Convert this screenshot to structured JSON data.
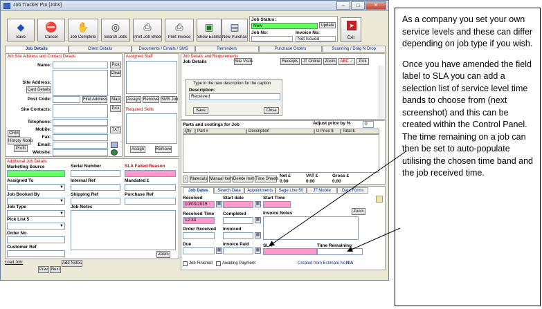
{
  "window": {
    "title": "Job Tracker Pro [Jobs]"
  },
  "toolbar": {
    "buttons": [
      {
        "label": "Save",
        "icon": "save-icon",
        "glyph": "◆"
      },
      {
        "label": "Cancel",
        "icon": "cancel-icon",
        "glyph": "⛔"
      },
      {
        "label": "Job Complete",
        "icon": "thumbs-up-icon",
        "glyph": "✋"
      },
      {
        "label": "Search Jobs",
        "icon": "binoculars-icon",
        "glyph": "◎"
      },
      {
        "label": "Print Job Sheet",
        "icon": "printer-icon",
        "glyph": "⎙"
      },
      {
        "label": "Print Invoice",
        "icon": "printer-icon",
        "glyph": "⎙"
      },
      {
        "label": "Show Estimate",
        "icon": "estimate-icon",
        "glyph": "▣"
      },
      {
        "label": "New Purchase",
        "icon": "purchase-icon",
        "glyph": "▤"
      }
    ],
    "exit_label": "Exit"
  },
  "status": {
    "job_status_label": "Job Status:",
    "job_status_value": "New",
    "update_label": "Update",
    "job_no_label": "Job No:",
    "invoice_no_label": "Invoice No:",
    "invoice_no_value": "Not Issued"
  },
  "tabs": [
    "Job Details",
    "Client Details",
    "Documents / Emails / SMS",
    "Reminders",
    "Purchase Orders",
    "Scanning / Drag N Drop"
  ],
  "left": {
    "section_title": "Job Site Address and Contact Details",
    "name_label": "Name:",
    "pick_label": "Pick",
    "clear_label": "Clear",
    "site_address_label": "Site Address:",
    "card_details_label": "Card Details",
    "post_code_label": "Post Code:",
    "find_address_label": "Find Address",
    "map_label": "Map",
    "site_contacts_label": "Site Contacts:",
    "pick2_label": "Pick",
    "telephone_label": "Telephone:",
    "mobile_label": "Mobile:",
    "txt_label": "TXT",
    "crm_label": "CRM",
    "fax_label": "Fax:",
    "history_notes_label": "History Notes",
    "email_label": "Email:",
    "profit_label": "Profit",
    "website_label": "Website:"
  },
  "staff": {
    "section_title": "Assigned Staff",
    "assign_label": "Assign",
    "remove_label": "Remove",
    "sms_job_label": "SMS Job",
    "required_skills_title": "Required Skills",
    "assign2_label": "Assign",
    "remove2_label": "Remove"
  },
  "additional": {
    "section_title": "Additional Job Details",
    "marketing_source_label": "Marketing Source",
    "serial_number_label": "Serial Number",
    "sla_failed_label": "SLA Failed Reason",
    "assigned_to_label": "Assigned To",
    "internal_ref_label": "Internal Ref",
    "mandated_label": "Mandated £",
    "job_booked_by_label": "Job Booked By",
    "shipping_ref_label": "Shipping Ref",
    "purchase_ref_label": "Purchase Ref",
    "job_type_label": "Job Type",
    "job_notes_label": "Job Notes",
    "pick_list_label": "Pick List 5",
    "order_no_label": "Order No",
    "customer_ref_label": "Customer Ref",
    "zoom_label": "Zoom",
    "load_job_label": "Load Job:",
    "add_notes_label": "Add Notes",
    "prev_label": "Prev",
    "next_label": "Next"
  },
  "job_details": {
    "section_title": "Job Details and Requirements",
    "title": "Job Details",
    "site_visits_label": "Site Visits",
    "receipts_label": "Receipts",
    "jt_online_label": "JT Online",
    "zoom_label": "Zoom",
    "abc_label": "ABC",
    "pick_label": "Pick",
    "caption_hint": "Type in the new description for the caption",
    "description_label": "Description:",
    "description_value": "Received",
    "save_label": "Save",
    "close_label": "Close"
  },
  "parts": {
    "title": "Parts and costings for Job",
    "adjust_label": "Adjust price by %",
    "adjust_value": "0",
    "columns": [
      "Qty",
      "Part #",
      "Description",
      "U Price $",
      "Total £"
    ],
    "materials_label": "Materials",
    "manual_item_label": "Manual Item",
    "delete_item_label": "Delete Item",
    "time_sheets_label": "Time Sheets",
    "net_label": "Net £",
    "net_value": "0.00",
    "vat_label": "VAT £",
    "vat_value": "0.00",
    "gross_label": "Gross £",
    "gross_value": "0.00"
  },
  "dates": {
    "tabs": [
      "Job Dates",
      "Search Data",
      "Appointments",
      "Sage Line 50",
      "JT Mobile",
      "Data Forms"
    ],
    "received_label": "Received",
    "received_value": "10/03/2015",
    "start_date_label": "Start date",
    "start_time_label": "Start Time",
    "received_time_label": "Received Time",
    "received_time_value": "12:34",
    "completed_label": "Completed",
    "invoice_notes_label": "Invoice Notes",
    "order_received_label": "Order Received",
    "invoiced_label": "Invoiced",
    "zoom_label": "Zoom",
    "due_label": "Due",
    "invoice_paid_label": "Invoice Paid",
    "sla_label": "SLA",
    "time_remaining_label": "Time Remaining",
    "job_finished_label": "Job Finished",
    "awaiting_payment_label": "Awaiting Payment",
    "created_from_label": "Created from Estimate No:",
    "created_from_value": "N/A"
  },
  "callout": {
    "p1": "As a company you set your own service levels and these can differ depending on job type if you wish.",
    "p2": "Once you have amended the field label to SLA you can add a selection list of service level time bands to choose from (next screenshot) and this can be created within the Control Panel. The time remaining on a job can then be set to auto-populate utilising the chosen time band and the job received time."
  }
}
